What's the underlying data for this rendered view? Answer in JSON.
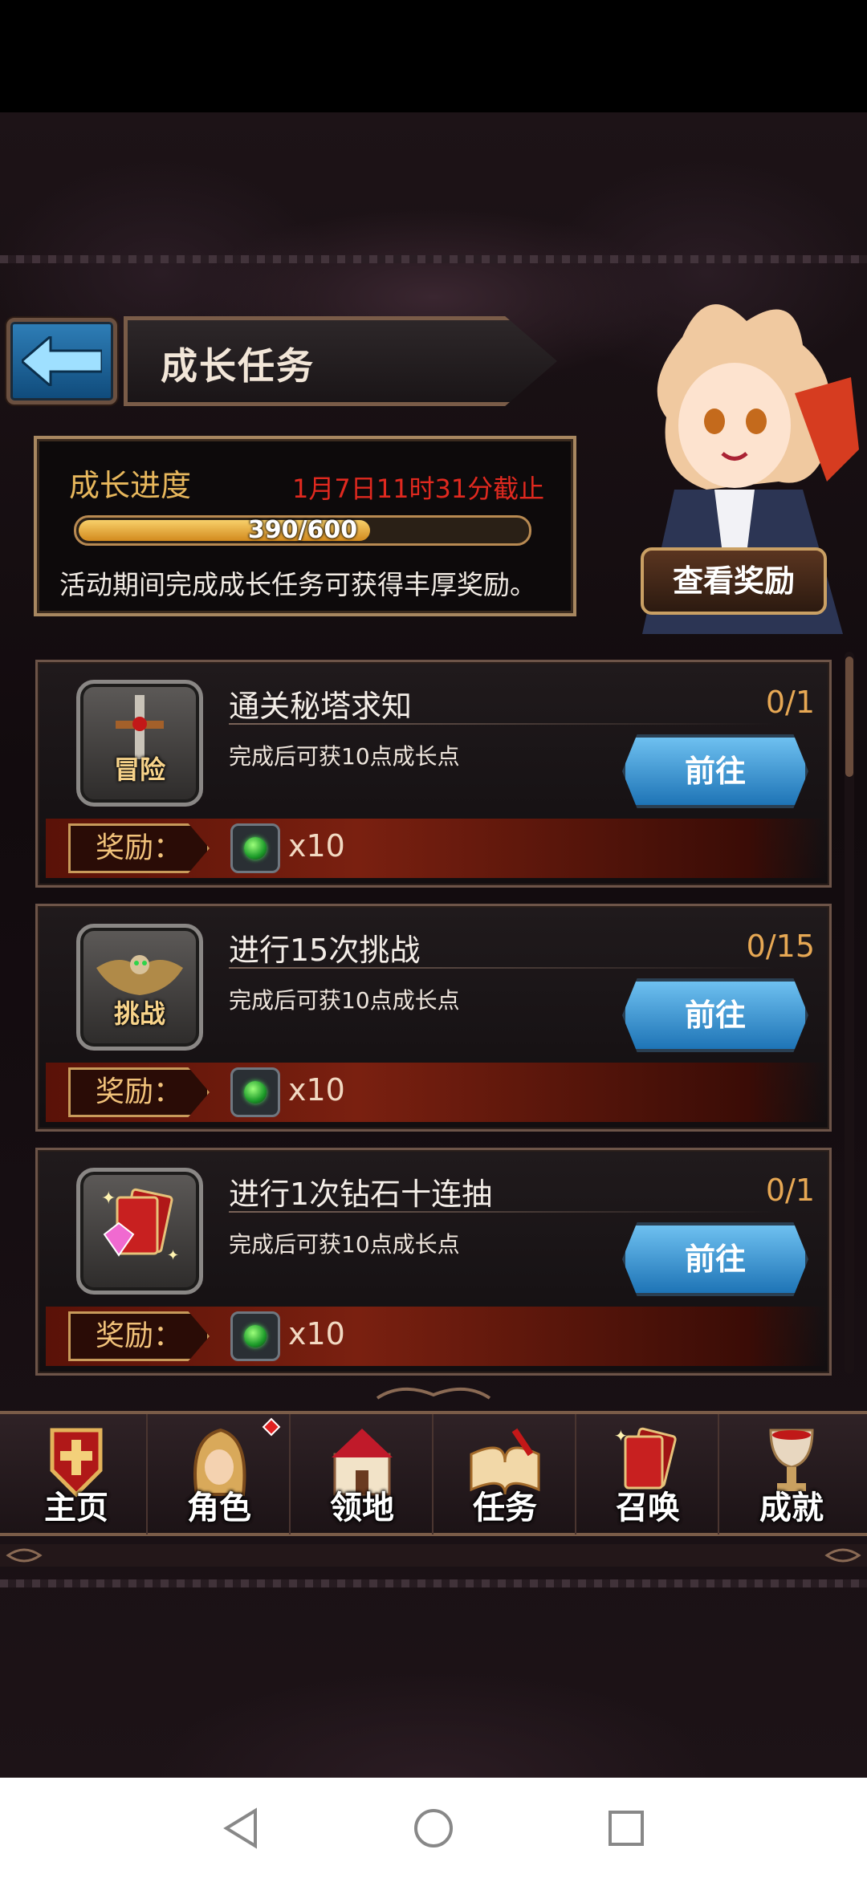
{
  "header": {
    "title": "成长任务"
  },
  "progress": {
    "label": "成长进度",
    "deadline": "1月7日11时31分截止",
    "current": 390,
    "max": 600,
    "value_text": "390/600",
    "description": "活动期间完成成长任务可获得丰厚奖励。",
    "view_rewards_label": "查看奖励"
  },
  "tasks": [
    {
      "icon": "adventure-sword-icon",
      "icon_label": "冒险",
      "title": "通关秘塔求知",
      "count": "0/1",
      "desc": "完成后可获10点成长点",
      "go_label": "前往",
      "reward_label": "奖励：",
      "reward_qty": "x10",
      "reward_icon": "green-gem-icon"
    },
    {
      "icon": "challenge-eagle-icon",
      "icon_label": "挑战",
      "title": "进行15次挑战",
      "count": "0/15",
      "desc": "完成后可获10点成长点",
      "go_label": "前往",
      "reward_label": "奖励：",
      "reward_qty": "x10",
      "reward_icon": "green-gem-icon"
    },
    {
      "icon": "diamond-cards-icon",
      "icon_label": "",
      "title": "进行1次钻石十连抽",
      "count": "0/1",
      "desc": "完成后可获10点成长点",
      "go_label": "前往",
      "reward_label": "奖励：",
      "reward_qty": "x10",
      "reward_icon": "green-gem-icon"
    }
  ],
  "nav": [
    {
      "label": "主页",
      "icon": "home-shield-icon"
    },
    {
      "label": "角色",
      "icon": "character-hood-icon",
      "badge": true
    },
    {
      "label": "领地",
      "icon": "castle-icon"
    },
    {
      "label": "任务",
      "icon": "quest-book-icon"
    },
    {
      "label": "召唤",
      "icon": "summon-cards-icon"
    },
    {
      "label": "成就",
      "icon": "trophy-icon"
    }
  ],
  "colors": {
    "accent_gold": "#e7a854",
    "deadline_red": "#e0291f",
    "go_blue": "#1e74b6"
  }
}
